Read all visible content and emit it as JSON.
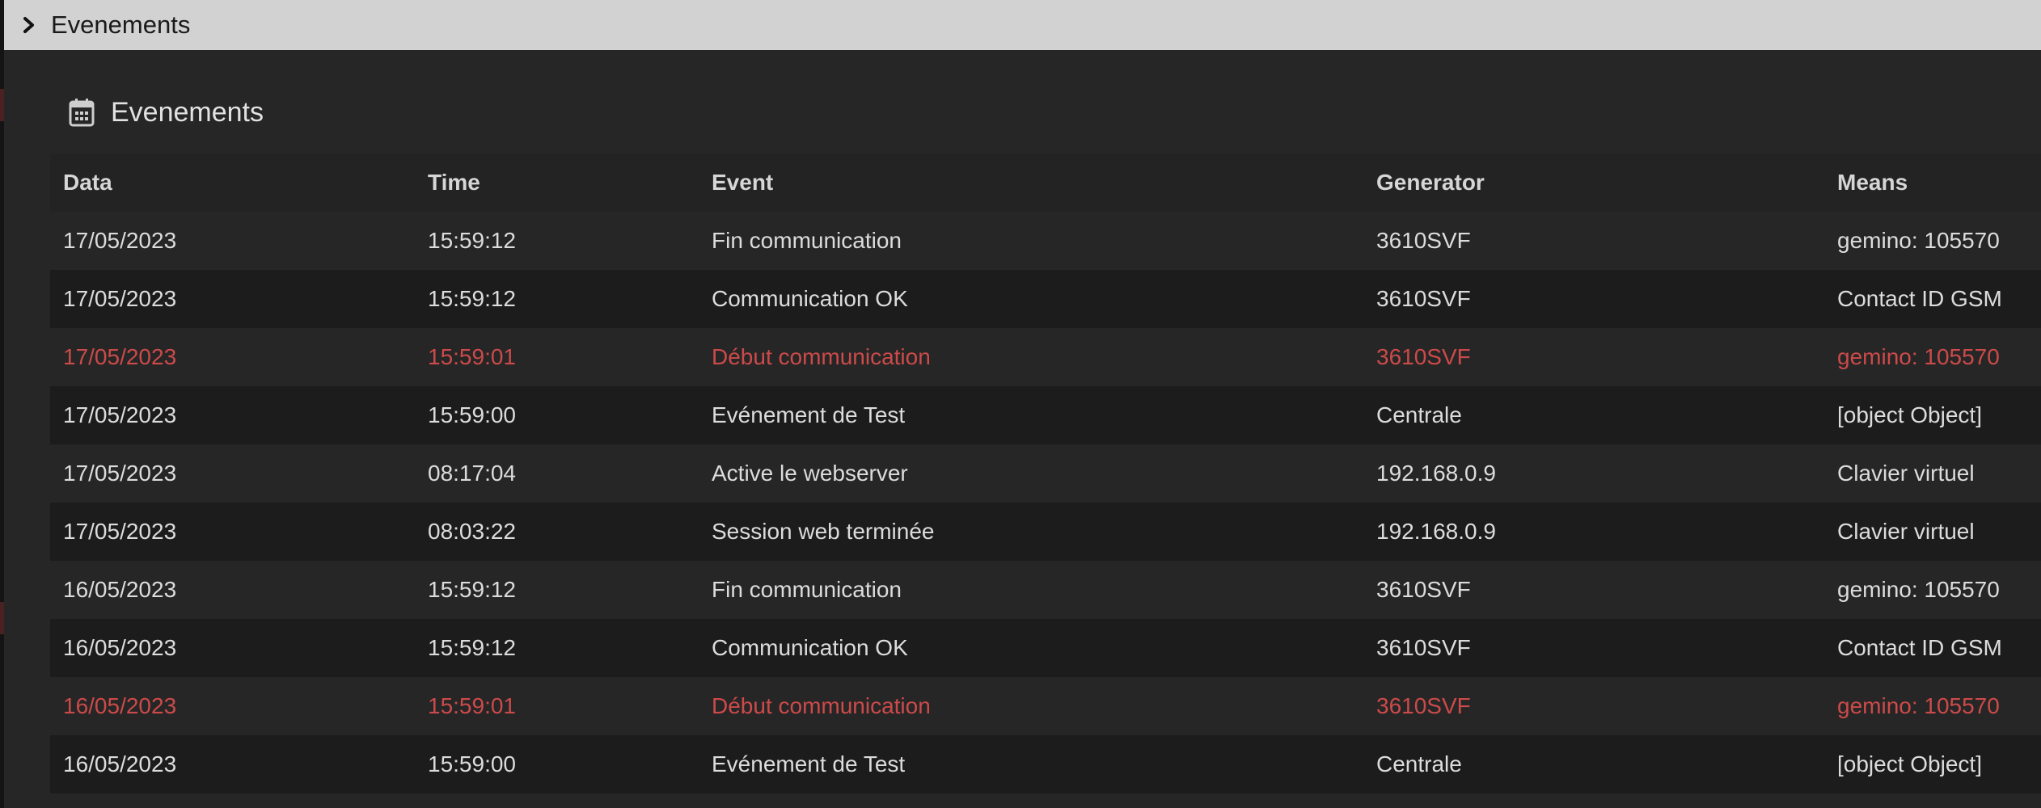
{
  "collapse": {
    "title": "Evenements",
    "icon": "chevron-right-icon"
  },
  "panel": {
    "title": "Evenements",
    "icon": "calendar-icon"
  },
  "colors": {
    "alert_text": "#cc4a4a",
    "header_bar": "#d2d2d2",
    "background": "#262626"
  },
  "table": {
    "columns": [
      "Data",
      "Time",
      "Event",
      "Generator",
      "Means"
    ],
    "rows": [
      {
        "data": "17/05/2023",
        "time": "15:59:12",
        "event": "Fin communication",
        "generator": "3610SVF",
        "means": "gemino: 105570",
        "alert": false
      },
      {
        "data": "17/05/2023",
        "time": "15:59:12",
        "event": "Communication OK",
        "generator": "3610SVF",
        "means": "Contact ID GSM",
        "alert": false
      },
      {
        "data": "17/05/2023",
        "time": "15:59:01",
        "event": "Début communication",
        "generator": "3610SVF",
        "means": "gemino: 105570",
        "alert": true
      },
      {
        "data": "17/05/2023",
        "time": "15:59:00",
        "event": "Evénement de Test",
        "generator": "Centrale",
        "means": "[object Object]",
        "alert": false
      },
      {
        "data": "17/05/2023",
        "time": "08:17:04",
        "event": "Active le webserver",
        "generator": "192.168.0.9",
        "means": "Clavier virtuel",
        "alert": false
      },
      {
        "data": "17/05/2023",
        "time": "08:03:22",
        "event": "Session web terminée",
        "generator": "192.168.0.9",
        "means": "Clavier virtuel",
        "alert": false
      },
      {
        "data": "16/05/2023",
        "time": "15:59:12",
        "event": "Fin communication",
        "generator": "3610SVF",
        "means": "gemino: 105570",
        "alert": false
      },
      {
        "data": "16/05/2023",
        "time": "15:59:12",
        "event": "Communication OK",
        "generator": "3610SVF",
        "means": "Contact ID GSM",
        "alert": false
      },
      {
        "data": "16/05/2023",
        "time": "15:59:01",
        "event": "Début communication",
        "generator": "3610SVF",
        "means": "gemino: 105570",
        "alert": true
      },
      {
        "data": "16/05/2023",
        "time": "15:59:00",
        "event": "Evénement de Test",
        "generator": "Centrale",
        "means": "[object Object]",
        "alert": false
      }
    ]
  }
}
